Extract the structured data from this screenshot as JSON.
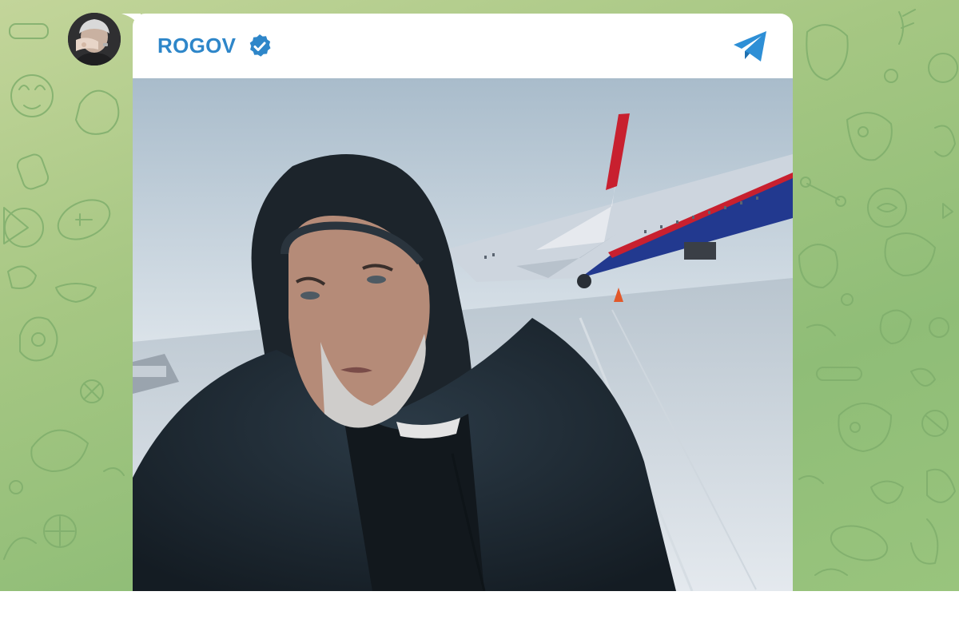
{
  "channel": {
    "name": "ROGOV",
    "verified": true,
    "avatar_icon": "profile-photo"
  },
  "post": {
    "media_type": "photo",
    "source_icon": "telegram-icon"
  },
  "colors": {
    "accent": "#2e86c9",
    "chat_background": "#a6c783",
    "bubble": "#ffffff"
  }
}
